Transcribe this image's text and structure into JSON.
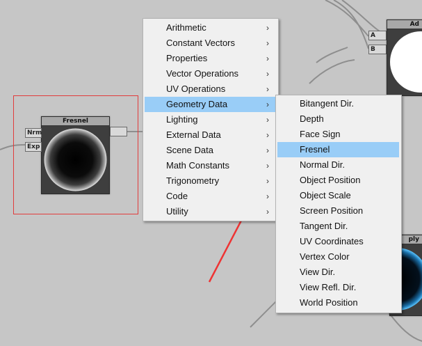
{
  "main_menu": {
    "items": [
      {
        "label": "Arithmetic"
      },
      {
        "label": "Constant Vectors"
      },
      {
        "label": "Properties"
      },
      {
        "label": "Vector Operations"
      },
      {
        "label": "UV Operations"
      },
      {
        "label": "Geometry Data"
      },
      {
        "label": "Lighting"
      },
      {
        "label": "External Data"
      },
      {
        "label": "Scene Data"
      },
      {
        "label": "Math Constants"
      },
      {
        "label": "Trigonometry"
      },
      {
        "label": "Code"
      },
      {
        "label": "Utility"
      }
    ],
    "highlighted": "Geometry Data",
    "arrow_glyph": "›"
  },
  "sub_menu": {
    "items": [
      {
        "label": "Bitangent Dir."
      },
      {
        "label": "Depth"
      },
      {
        "label": "Face Sign"
      },
      {
        "label": "Fresnel"
      },
      {
        "label": "Normal Dir."
      },
      {
        "label": "Object Position"
      },
      {
        "label": "Object Scale"
      },
      {
        "label": "Screen Position"
      },
      {
        "label": "Tangent Dir."
      },
      {
        "label": "UV Coordinates"
      },
      {
        "label": "Vertex Color"
      },
      {
        "label": "View Dir."
      },
      {
        "label": "View Refl. Dir."
      },
      {
        "label": "World Position"
      }
    ],
    "highlighted": "Fresnel"
  },
  "nodes": {
    "fresnel": {
      "title": "Fresnel",
      "inputs": [
        "Nrm",
        "Exp"
      ]
    },
    "add": {
      "title": "Ad",
      "inputs": [
        "A",
        "B"
      ]
    },
    "multiply": {
      "title": "ply"
    }
  },
  "colors": {
    "canvas_bg": "#c6c6c6",
    "menu_highlight": "#99cdf7",
    "selection_border": "#e23b3b",
    "annotation_arrow": "#ee3333"
  }
}
